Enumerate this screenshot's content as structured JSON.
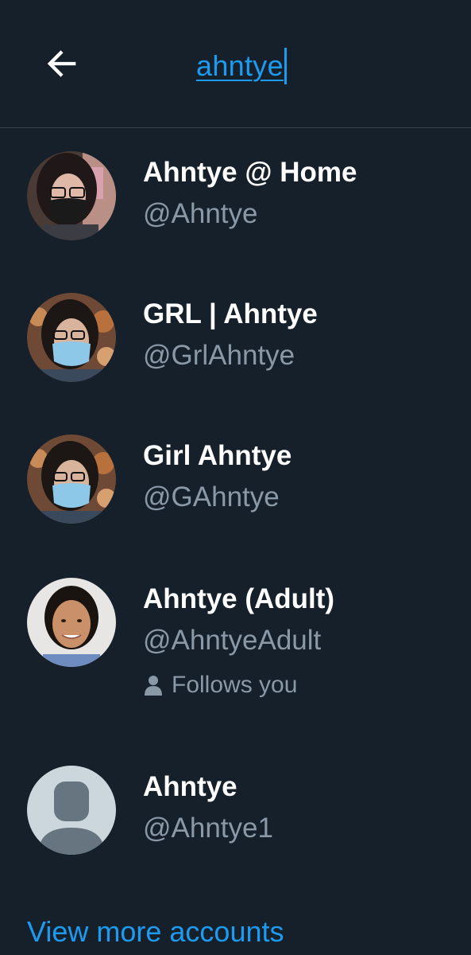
{
  "header": {
    "back_icon": "arrow-left-icon",
    "search_query": "ahntye"
  },
  "colors": {
    "background": "#15202b",
    "accent": "#1d9bf0",
    "secondary_text": "#8b98a5",
    "divider": "#38444d"
  },
  "results": [
    {
      "name": "Ahntye @ Home",
      "handle": "@Ahntye"
    },
    {
      "name": "GRL | Ahntye",
      "handle": "@GrlAhntye"
    },
    {
      "name": "Girl Ahntye",
      "handle": "@GAhntye"
    },
    {
      "name": "Ahntye (Adult)",
      "handle": "@AhntyeAdult",
      "follows_you": "Follows you",
      "follows_icon": "person-icon"
    },
    {
      "name": "Ahntye",
      "handle": "@Ahntye1",
      "avatar": "default-avatar-icon"
    }
  ],
  "footer": {
    "view_more": "View more accounts"
  }
}
